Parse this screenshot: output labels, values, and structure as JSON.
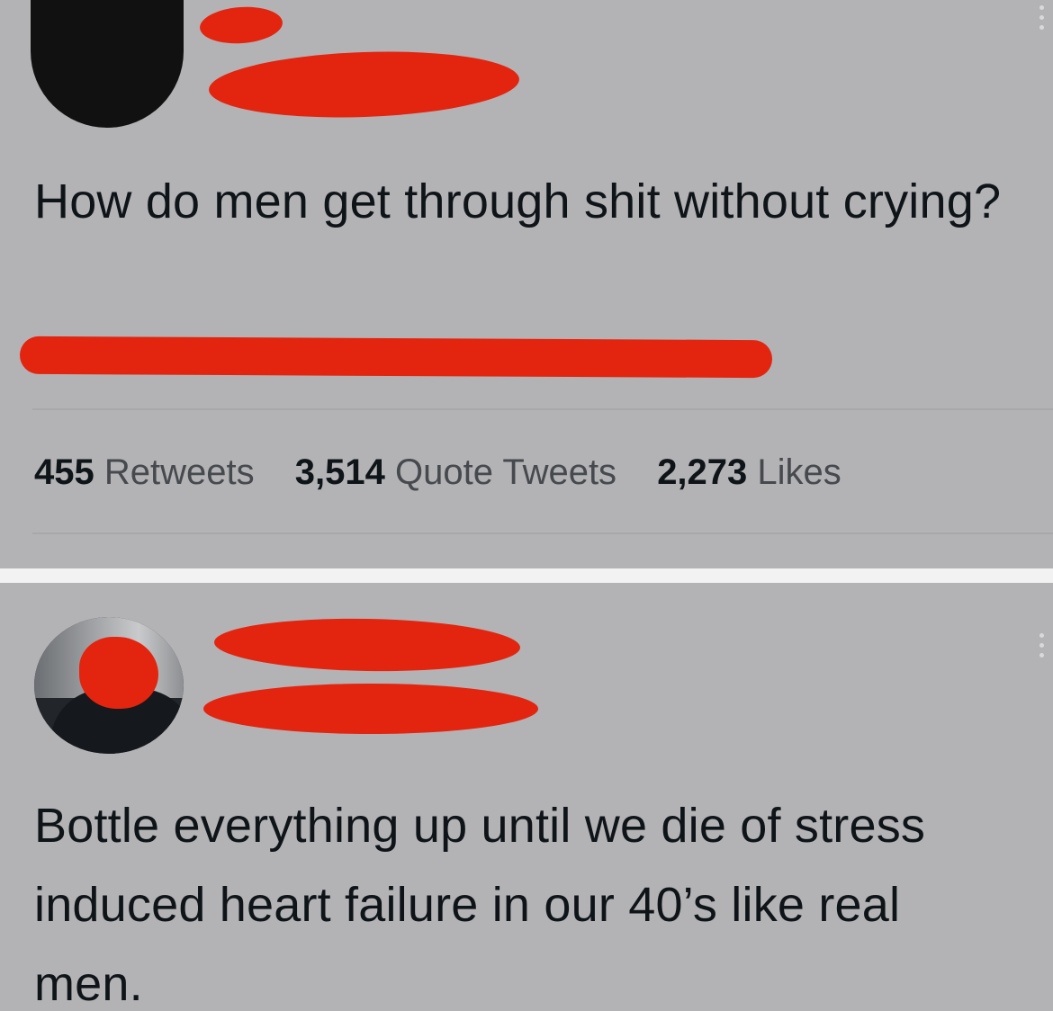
{
  "original_tweet": {
    "text": "How do men get through shit without crying?",
    "stats": {
      "retweets_count": "455",
      "retweets_label": "Retweets",
      "quotes_count": "3,514",
      "quotes_label": "Quote Tweets",
      "likes_count": "2,273",
      "likes_label": "Likes"
    },
    "more_icon": "more-options-icon"
  },
  "reply_tweet": {
    "text": "Bottle everything up until we die of stress induced heart failure in our 40’s like real men.",
    "more_icon": "more-options-icon"
  },
  "colors": {
    "card_background": "#b3b3b5",
    "redaction": "#e3240f",
    "text": "#0f1419",
    "secondary_text": "#46494d"
  }
}
